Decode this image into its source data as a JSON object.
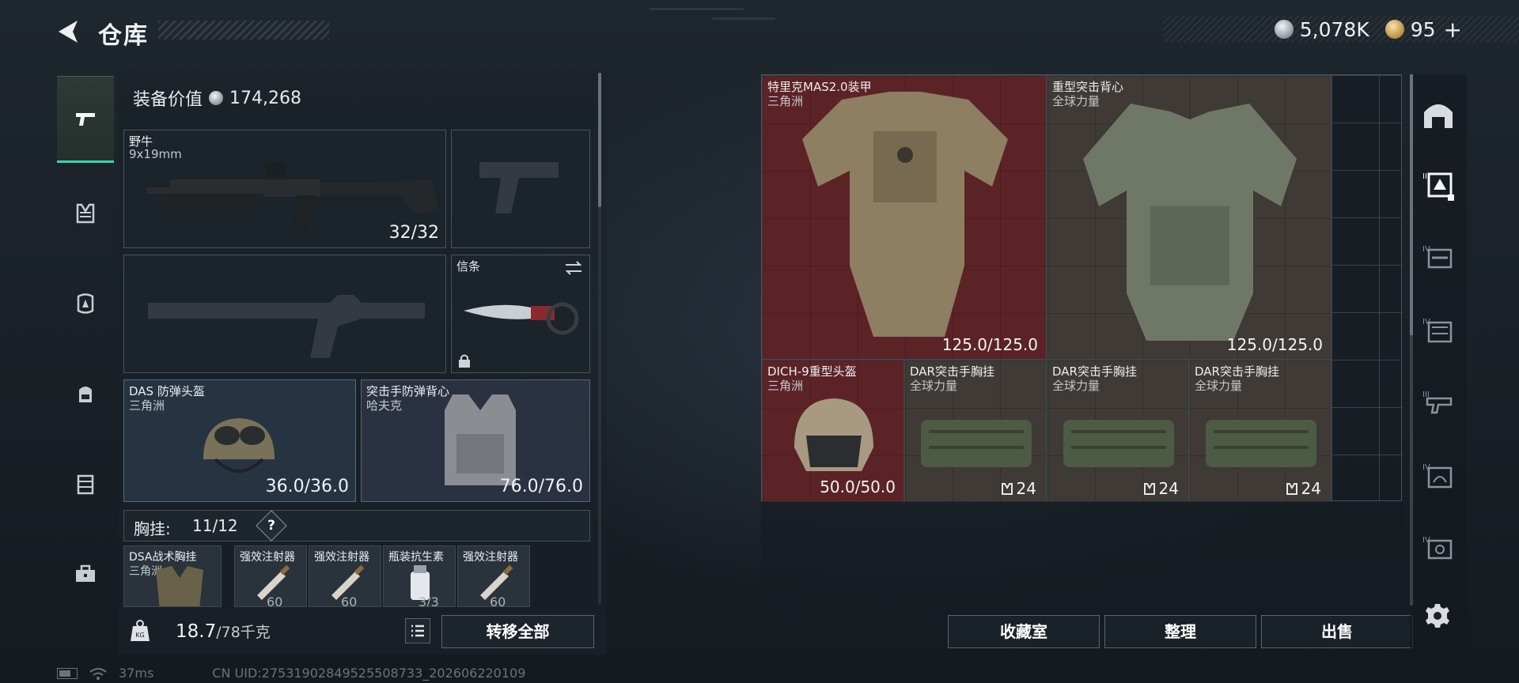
{
  "header": {
    "title": "仓库",
    "currency_silver": "5,078K",
    "currency_gold": "95",
    "currency_gold_suffix": "+"
  },
  "left_rail": {
    "icons": [
      "pistol-icon",
      "vest-rig-icon",
      "armor-plate-icon",
      "backpack-icon",
      "container-icon",
      "toolbox-icon"
    ],
    "active": "pistol-icon"
  },
  "loadout": {
    "value_label": "装备价值",
    "value": "174,268",
    "primary": {
      "name": "野牛",
      "sub": "9x19mm",
      "ammo": "32/32"
    },
    "melee": {
      "name": "信条"
    },
    "helmet": {
      "name": "DAS 防弹头盔",
      "sub": "三角洲",
      "durability": "36.0/36.0"
    },
    "armor": {
      "name": "突击手防弹背心",
      "sub": "哈夫克",
      "durability": "76.0/76.0"
    },
    "vest": {
      "label": "胸挂:",
      "count": "11/12",
      "help": "?"
    },
    "vest_items": [
      {
        "name": "DSA战术胸挂",
        "sub": "三角洲",
        "val": ""
      },
      {
        "name": "强效注射器",
        "sub": "",
        "val": "60"
      },
      {
        "name": "强效注射器",
        "sub": "",
        "val": "60"
      },
      {
        "name": "瓶装抗生素",
        "sub": "",
        "val": "3/3"
      },
      {
        "name": "强效注射器",
        "sub": "",
        "val": "60"
      }
    ],
    "weight": "18.7",
    "weight_max": "/78千克",
    "transfer_all": "转移全部"
  },
  "status": {
    "ping": "37ms",
    "uid": "CN UID:2753190284952550873​3_202606220109"
  },
  "stash": {
    "items": [
      {
        "name": "特里克MAS2.0装甲",
        "sub": "三角洲",
        "val": "125.0/125.0"
      },
      {
        "name": "重型突击背心",
        "sub": "全球力量",
        "val": "125.0/125.0"
      },
      {
        "name": "DICH-9重型头盔",
        "sub": "三角洲",
        "val": "50.0/50.0"
      },
      {
        "name": "DAR突击手胸挂",
        "sub": "全球力量",
        "val": "24"
      },
      {
        "name": "DAR突击手胸挂",
        "sub": "全球力量",
        "val": "24"
      },
      {
        "name": "DAR突击手胸挂",
        "sub": "全球力量",
        "val": "24"
      }
    ],
    "buttons": {
      "collection": "收藏室",
      "sort": "整理",
      "sell": "出售"
    }
  },
  "right_rail": {
    "icons": [
      "all-items-icon",
      "tier3-armor-filter-icon",
      "tier4-gun-filter-icon",
      "tier4-armor-filter-icon",
      "tier3-gun-filter-icon",
      "tier4-helmet-filter-icon",
      "tier4-misc-filter-icon"
    ],
    "tiers": [
      "",
      "III",
      "IV",
      "IV",
      "III",
      "IV",
      "IV"
    ]
  },
  "colors": {
    "accent": "#36d8a8",
    "item_red": "#5c2326",
    "item_brown": "#3f3a35"
  }
}
